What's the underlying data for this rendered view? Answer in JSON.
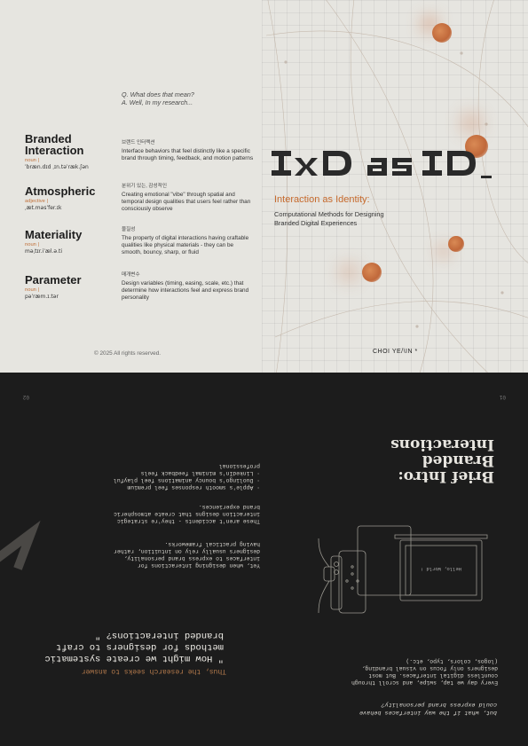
{
  "cover": {
    "qa": [
      "Q. What does that mean?",
      "A. Well, In my research..."
    ],
    "terms": [
      {
        "title_lines": [
          "Branded",
          "Interaction"
        ],
        "pos": "noun |",
        "pron": "ˈbræn.dɪd ˌɪn.təˈræk.ʃən",
        "kr": "브랜드 인터랙션",
        "definition": "Interface behaviors that feel distinctly like a specific brand through timing, feedback, and motion patterns"
      },
      {
        "title_lines": [
          "Atmospheric"
        ],
        "pos": "adjective |",
        "pron": "ˌæt.məsˈfer.ɪk",
        "kr": "분위기 있는, 감성적인",
        "definition": "Creating emotional \"vibe\" through spatial and temporal design qualities that users feel rather than consciously observe"
      },
      {
        "title_lines": [
          "Materiality"
        ],
        "pos": "noun |",
        "pron": "məˌtɪr.iˈæl.ə.ti",
        "kr": "물질성",
        "definition": "The property of digital interactions having craftable qualities like physical materials - they can be smooth, bouncy, sharp, or fluid"
      },
      {
        "title_lines": [
          "Parameter"
        ],
        "pos": "noun |",
        "pron": "pəˈræm.ɪ.tər",
        "kr": "매개변수",
        "definition": "Design variables (timing, easing, scale, etc.) that determine how interactions feel and express brand personality"
      }
    ],
    "logo_text": "IxD as ID",
    "subtitle_accent": "Interaction as Identity:",
    "subtitle_lines": [
      "Computational Methods for Designing",
      "Branded Digital Experiences"
    ],
    "copyright": "© 2025 All rights reserved.",
    "author": "CHOI YE/\\IN *",
    "accent_color": "#c66a2d",
    "background_color": "#e6e5e0"
  },
  "inner": {
    "page_left": "01",
    "page_right": "02",
    "title_lines": [
      "Brief Intro:",
      "Branded",
      "Interactions"
    ],
    "bullets": [
      "·  Apple's smooth responses feel premium",
      "·  Duolingo's bouncy animations feel playful",
      "·  LinkedIn's minimal feedback feels",
      "   professional"
    ],
    "para1": [
      "These aren't accidents - they're strategic",
      "interaction designs that create atmospheric",
      "brand experiences."
    ],
    "para2": [
      "Yet, when designing interactions for",
      "interfaces to express brand personality,",
      "designers usually rely on intuition, rather",
      "having practical frameworks."
    ],
    "research_label": "Thus, the research seeks to answer",
    "research_question": [
      "\" How might we create systematic",
      "methods for designers to craft",
      "branded interactions? \""
    ],
    "intro_para": [
      "Every day we tap, swipe, and scroll through",
      "countless digital interfaces. But most",
      "designers only focus on visual branding,",
      "(logos, colors, typo, etc.)"
    ],
    "intro_question": [
      "but, what if the way interfaces behave",
      "could express brand personality?"
    ],
    "device_text": "Hello, World !",
    "background_color": "#1c1c1c"
  }
}
